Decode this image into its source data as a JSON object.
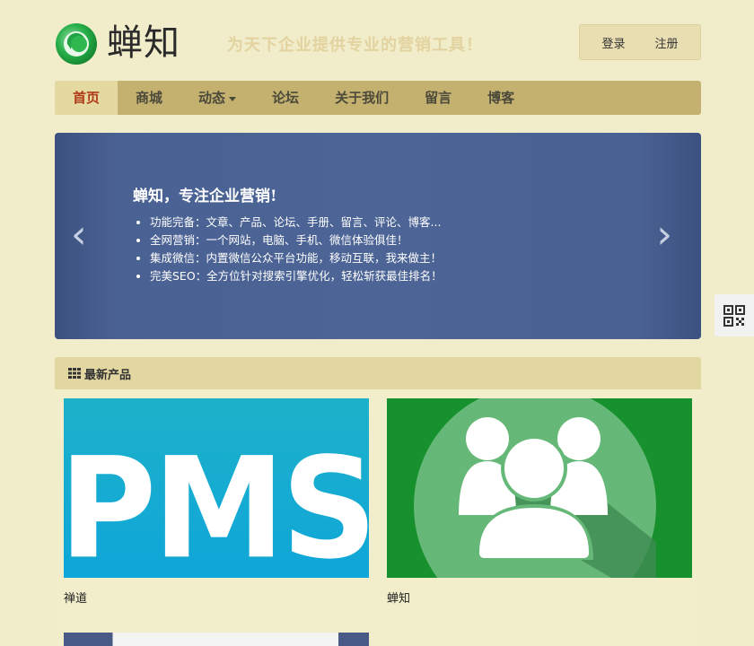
{
  "header": {
    "brand": "蝉知",
    "slogan": "为天下企业提供专业的营销工具！",
    "login": "登录",
    "register": "注册"
  },
  "nav": {
    "items": [
      {
        "label": "首页",
        "active": true
      },
      {
        "label": "商城"
      },
      {
        "label": "动态",
        "dropdown": true
      },
      {
        "label": "论坛"
      },
      {
        "label": "关于我们"
      },
      {
        "label": "留言"
      },
      {
        "label": "博客"
      }
    ]
  },
  "carousel": {
    "title": "蝉知，专注企业营销!",
    "features": [
      "功能完备：文章、产品、论坛、手册、留言、评论、博客...",
      "全网营销：一个网站，电脑、手机、微信体验俱佳！",
      "集成微信：内置微信公众平台功能，移动互联，我来做主！",
      "完美SEO：全方位针对搜索引擎优化，轻松斩获最佳排名！"
    ],
    "prev_icon": "‹",
    "next_icon": "›"
  },
  "products": {
    "section_title": "最新产品",
    "items": [
      {
        "name": "禅道",
        "image_text": "PMS"
      },
      {
        "name": "蝉知"
      }
    ]
  },
  "colors": {
    "page_bg": "#f1ecc9",
    "nav_bg": "#c4b06f",
    "nav_active": "#e5d9a2",
    "carousel_bg": "#4d6596"
  }
}
